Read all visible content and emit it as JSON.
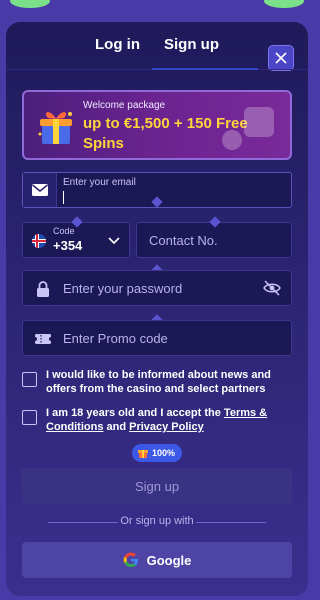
{
  "tabs": {
    "login": "Log in",
    "signup": "Sign up"
  },
  "banner": {
    "small": "Welcome package",
    "big": "up to €1,500 + 150 Free Spins"
  },
  "email": {
    "placeholder": "Enter your email"
  },
  "phone": {
    "code_label": "Code",
    "code_value": "+354",
    "placeholder": "Contact No."
  },
  "password": {
    "placeholder": "Enter your password"
  },
  "promo": {
    "placeholder": "Enter Promo code"
  },
  "checks": {
    "news": "I would like to be informed about news and offers from the casino and select partners",
    "age_prefix": "I am 18 years old and I accept the ",
    "terms_link": "Terms & Conditions",
    "and": " and ",
    "privacy_link": "Privacy Policy"
  },
  "badge": {
    "text": "100%"
  },
  "signup_button": "Sign up",
  "or_text": "Or sign up with",
  "google_button": "Google",
  "colors": {
    "accent_yellow": "#ffd43b",
    "modal_bg": "#2c2472",
    "badge_blue": "#3b59e6"
  },
  "icons": [
    "close-icon",
    "gift-icon",
    "mail-icon",
    "iceland-flag-icon",
    "chevron-down-icon",
    "lock-icon",
    "eye-off-icon",
    "ticket-icon",
    "google-icon"
  ]
}
